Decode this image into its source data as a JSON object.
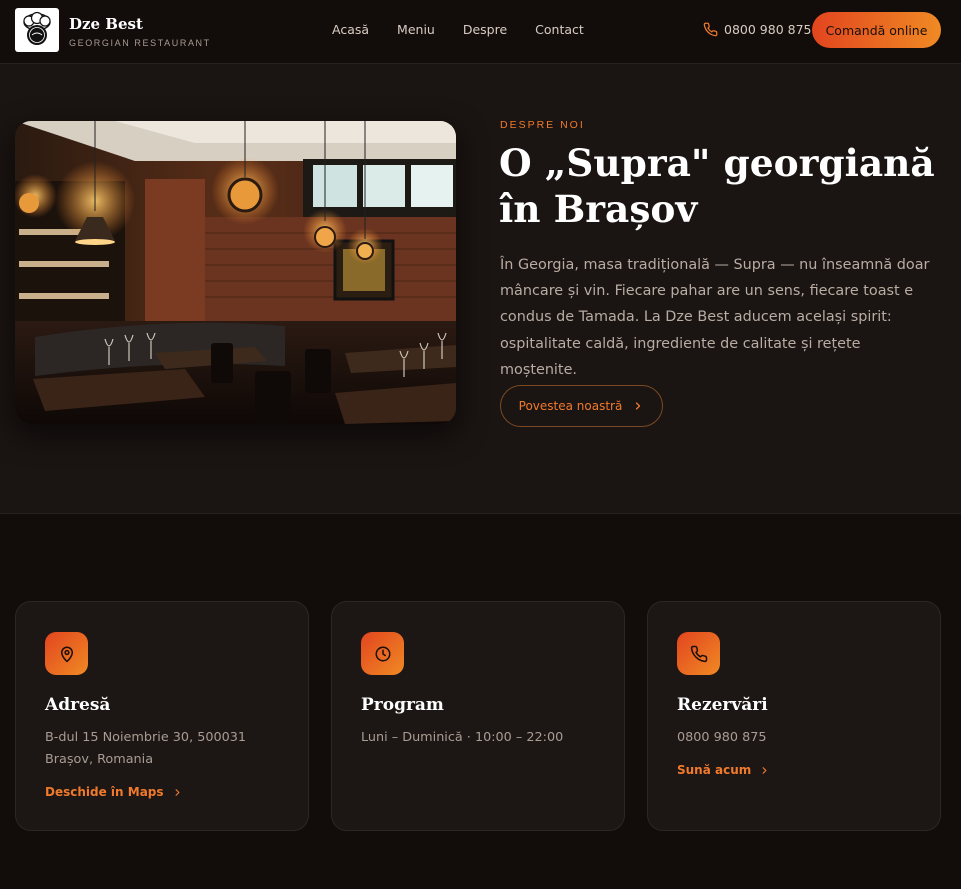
{
  "header": {
    "brand_name": "Dze Best",
    "brand_sub": "GEORGIAN RESTAURANT",
    "nav": [
      "Acasă",
      "Meniu",
      "Despre",
      "Contact"
    ],
    "phone": "0800 980 875",
    "order_label": "Comandă online"
  },
  "about": {
    "eyebrow": "DESPRE NOI",
    "title": "O „Supra\" georgiană în Brașov",
    "text": "În Georgia, masa tradițională — Supra — nu înseamnă doar mâncare și vin. Fiecare pahar are un sens, fiecare toast e condus de Tamada. La Dze Best aducem același spirit: ospitalitate caldă, ingrediente de calitate și rețete moștenite.",
    "button_label": "Povestea noastră"
  },
  "cards": [
    {
      "title": "Adresă",
      "text": "B-dul 15 Noiembrie 30, 500031 Brașov, Romania",
      "link": "Deschide în Maps",
      "icon": "map-pin-icon"
    },
    {
      "title": "Program",
      "text": "Luni – Duminică · 10:00 – 22:00",
      "link": "",
      "icon": "clock-icon"
    },
    {
      "title": "Rezervări",
      "text": "0800 980 875",
      "link": "Sună acum",
      "icon": "phone-icon"
    }
  ],
  "colors": {
    "accent": "#f07a2c",
    "accent_dark": "#e2451f",
    "background": "#120d0b",
    "section_bg": "#1a1412"
  }
}
